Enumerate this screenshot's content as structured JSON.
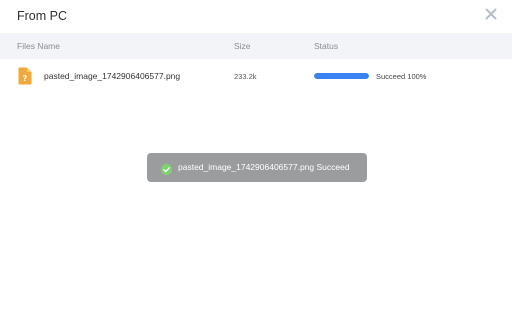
{
  "dialog": {
    "title": "From PC"
  },
  "table": {
    "headers": {
      "name": "Files Name",
      "size": "Size",
      "status": "Status"
    },
    "rows": [
      {
        "name": "pasted_image_1742906406577.png",
        "size": "233.2k",
        "progress": 1.0,
        "status": "Succeed 100%"
      }
    ]
  },
  "toast": {
    "message": "pasted_image_1742906406577.png Succeed"
  },
  "colors": {
    "accent": "#3a82f0",
    "file_icon": "#f2a93b",
    "toast_bg": "#9b9c9d",
    "success": "#7ed070"
  }
}
